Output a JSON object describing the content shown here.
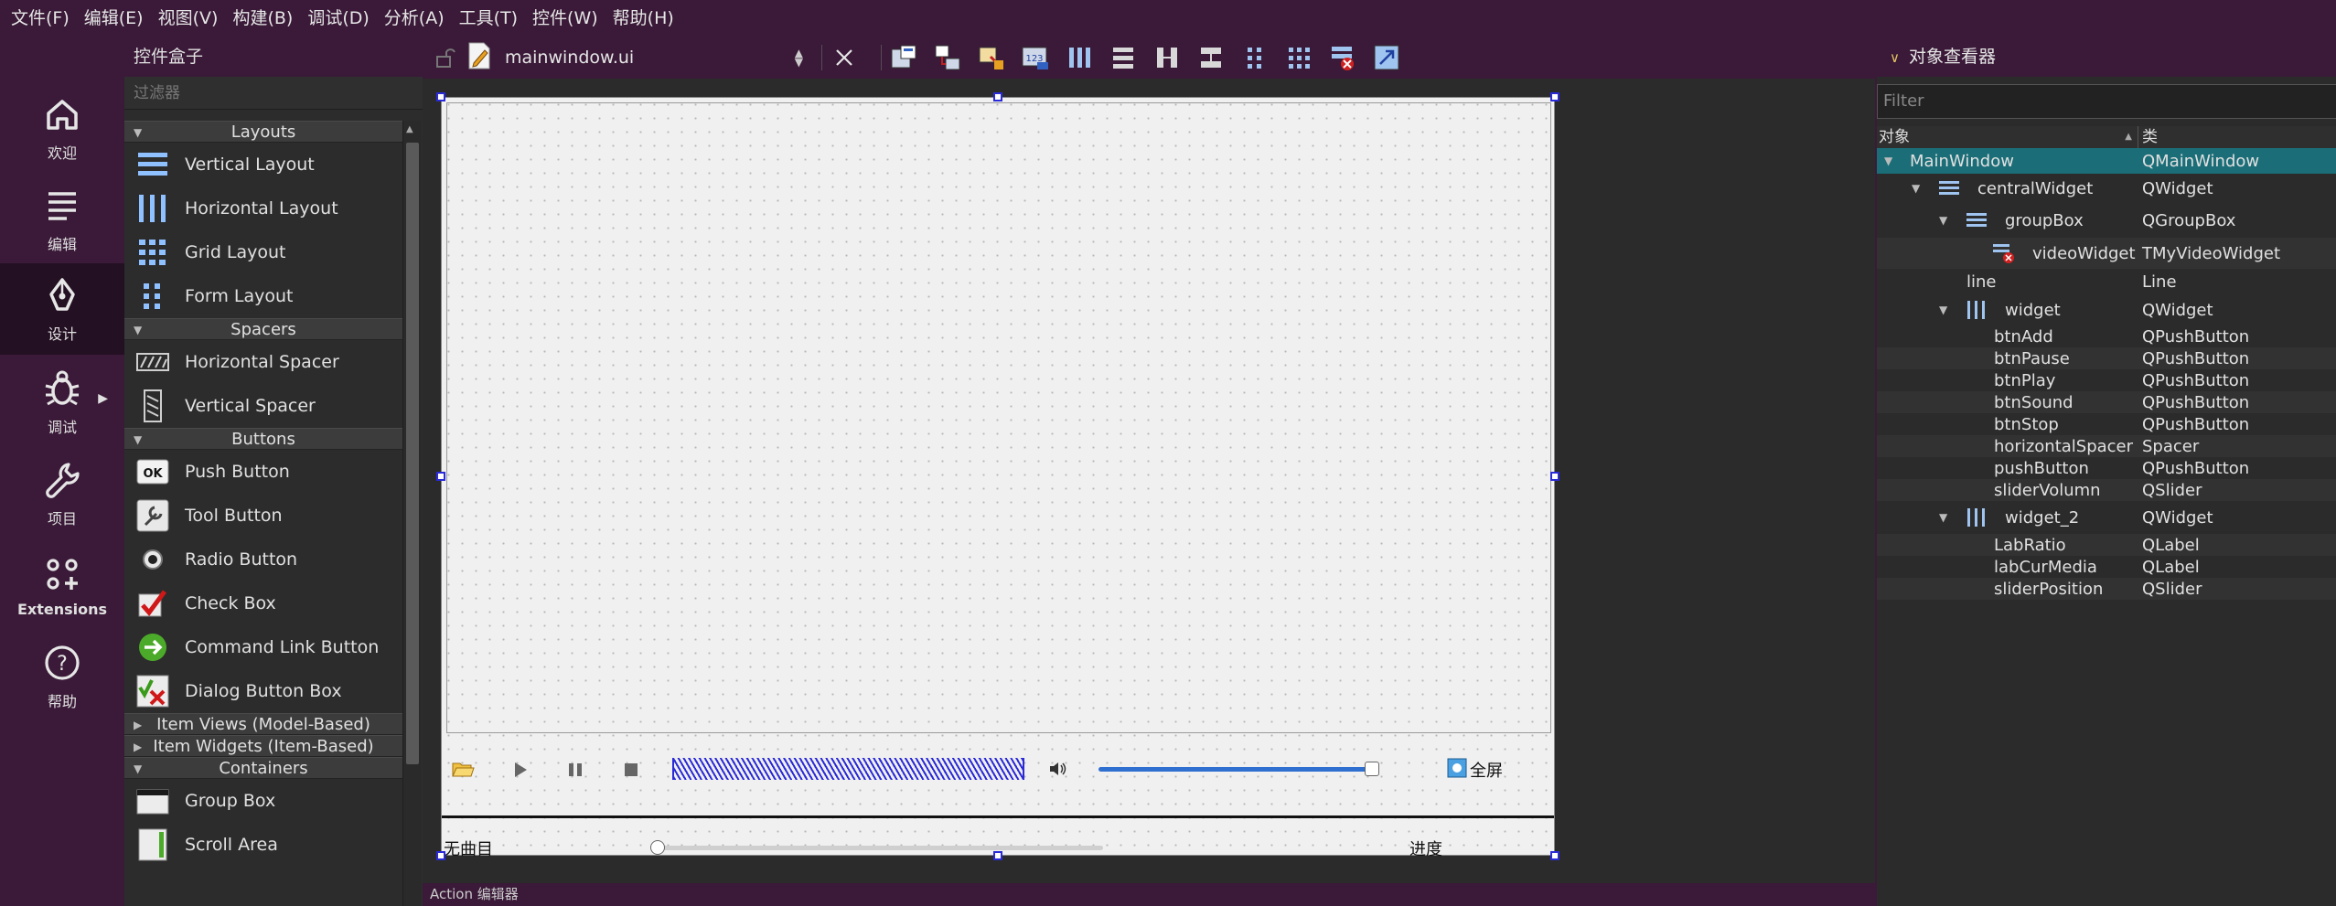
{
  "menubar": {
    "items": [
      "文件(F)",
      "编辑(E)",
      "视图(V)",
      "构建(B)",
      "调试(D)",
      "分析(A)",
      "工具(T)",
      "控件(W)",
      "帮助(H)"
    ]
  },
  "modebar": {
    "welcome": "欢迎",
    "edit": "编辑",
    "design": "设计",
    "debug": "调试",
    "project": "项目",
    "extensions": "Extensions",
    "help": "帮助"
  },
  "widgetbox": {
    "title": "控件盒子",
    "filter_placeholder": "过滤器",
    "categories": {
      "layouts": "Layouts",
      "spacers": "Spacers",
      "buttons": "Buttons",
      "item_views": "Item Views (Model-Based)",
      "item_widgets": "Item Widgets (Item-Based)",
      "containers": "Containers"
    },
    "items": {
      "vertical_layout": "Vertical Layout",
      "horizontal_layout": "Horizontal Layout",
      "grid_layout": "Grid Layout",
      "form_layout": "Form Layout",
      "horizontal_spacer": "Horizontal Spacer",
      "vertical_spacer": "Vertical Spacer",
      "push_button": "Push Button",
      "tool_button": "Tool Button",
      "radio_button": "Radio Button",
      "check_box": "Check Box",
      "command_link_button": "Command Link Button",
      "dialog_button_box": "Dialog Button Box",
      "group_box": "Group Box",
      "scroll_area": "Scroll Area"
    }
  },
  "editor": {
    "filename": "mainwindow.ui",
    "action_editor": "Action 编辑器"
  },
  "form": {
    "fullscreen_label": "全屏",
    "no_media_label": "无曲目",
    "progress_label": "进度",
    "volume_level": 0.97,
    "position_level": 0.0
  },
  "inspector": {
    "title": "对象查看器",
    "filter_placeholder": "Filter",
    "col_object": "对象",
    "col_class": "类",
    "rows": [
      {
        "name": "MainWindow",
        "cls": "QMainWindow"
      },
      {
        "name": "centralWidget",
        "cls": "QWidget"
      },
      {
        "name": "groupBox",
        "cls": "QGroupBox"
      },
      {
        "name": "videoWidget",
        "cls": "TMyVideoWidget"
      },
      {
        "name": "line",
        "cls": "Line"
      },
      {
        "name": "widget",
        "cls": "QWidget"
      },
      {
        "name": "btnAdd",
        "cls": "QPushButton"
      },
      {
        "name": "btnPause",
        "cls": "QPushButton"
      },
      {
        "name": "btnPlay",
        "cls": "QPushButton"
      },
      {
        "name": "btnSound",
        "cls": "QPushButton"
      },
      {
        "name": "btnStop",
        "cls": "QPushButton"
      },
      {
        "name": "horizontalSpacer",
        "cls": "Spacer"
      },
      {
        "name": "pushButton",
        "cls": "QPushButton"
      },
      {
        "name": "sliderVolumn",
        "cls": "QSlider"
      },
      {
        "name": "widget_2",
        "cls": "QWidget"
      },
      {
        "name": "LabRatio",
        "cls": "QLabel"
      },
      {
        "name": "labCurMedia",
        "cls": "QLabel"
      },
      {
        "name": "sliderPosition",
        "cls": "QSlider"
      }
    ]
  },
  "colors": {
    "chrome_purple": "#3a1a38",
    "selection_teal": "#1b6e78",
    "handle_blue": "#2a2ad8"
  }
}
